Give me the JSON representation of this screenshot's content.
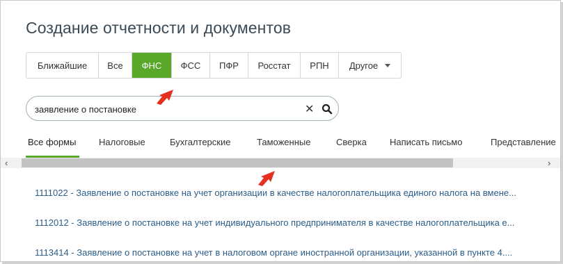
{
  "page": {
    "title": "Создание отчетности и документов"
  },
  "top_tabs": [
    {
      "label": "Ближайшие",
      "active": false
    },
    {
      "label": "Все",
      "active": false
    },
    {
      "label": "ФНС",
      "active": true
    },
    {
      "label": "ФСС",
      "active": false
    },
    {
      "label": "ПФР",
      "active": false
    },
    {
      "label": "Росстат",
      "active": false
    },
    {
      "label": "РПН",
      "active": false
    },
    {
      "label": "Другое",
      "active": false
    }
  ],
  "search": {
    "value": "заявление о постановке",
    "clear_icon": "close-icon",
    "search_icon": "search-icon"
  },
  "sub_tabs": [
    {
      "label": "Все формы",
      "active": true
    },
    {
      "label": "Налоговые",
      "active": false
    },
    {
      "label": "Бухгалтерские",
      "active": false
    },
    {
      "label": "Таможенные",
      "active": false
    },
    {
      "label": "Сверка",
      "active": false
    },
    {
      "label": "Написать письмо",
      "active": false
    },
    {
      "label": "Представление",
      "active": false
    }
  ],
  "scrollbar": {
    "left_arrow": "‹",
    "right_arrow": "›"
  },
  "forms": [
    "1111022 - Заявление о постановке на учет организации в качестве налогоплательщика единого налога на вмене...",
    "1112012 - Заявление о постановке на учет индивидуального предпринимателя в качестве налогоплательщика е...",
    "1113414 - Заявление о постановке на учет в налоговом органе иностранной организации, указанной в пункте 4...."
  ],
  "colors": {
    "accent": "#5aa82a",
    "link": "#2b5d8a",
    "title": "#3a4a56",
    "annotation_arrow": "#e53020"
  }
}
